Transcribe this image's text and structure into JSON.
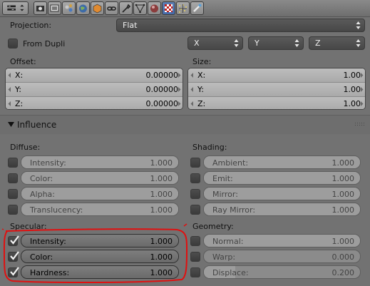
{
  "toolbar": {
    "icons": [
      "menu-toggle-icon",
      "render-icon",
      "render-layers-icon",
      "scene-icon",
      "world-icon",
      "object-icon",
      "constraints-icon",
      "modifiers-icon",
      "data-icon",
      "material-icon",
      "texture-icon",
      "particles-icon",
      "physics-icon"
    ],
    "active_index": 10
  },
  "mapping": {
    "projection_label": "Projection:",
    "projection_value": "Flat",
    "from_dupli_label": "From Dupli",
    "axes": [
      "X",
      "Y",
      "Z"
    ]
  },
  "offset": {
    "label": "Offset:",
    "rows": [
      {
        "axis": "X:",
        "value": "0.00000"
      },
      {
        "axis": "Y:",
        "value": "0.00000"
      },
      {
        "axis": "Z:",
        "value": "0.00000"
      }
    ]
  },
  "size": {
    "label": "Size:",
    "rows": [
      {
        "axis": "X:",
        "value": "1.00"
      },
      {
        "axis": "Y:",
        "value": "1.00"
      },
      {
        "axis": "Z:",
        "value": "1.00"
      }
    ]
  },
  "influence": {
    "title": "Influence",
    "diffuse": {
      "label": "Diffuse:",
      "items": [
        {
          "label": "Intensity:",
          "value": "1.000",
          "checked": false,
          "fill": 1.0
        },
        {
          "label": "Color:",
          "value": "1.000",
          "checked": false,
          "fill": 1.0
        },
        {
          "label": "Alpha:",
          "value": "1.000",
          "checked": false,
          "fill": 1.0
        },
        {
          "label": "Translucency:",
          "value": "1.000",
          "checked": false,
          "fill": 1.0
        }
      ]
    },
    "shading": {
      "label": "Shading:",
      "items": [
        {
          "label": "Ambient:",
          "value": "1.000",
          "checked": false,
          "fill": 1.0
        },
        {
          "label": "Emit:",
          "value": "1.000",
          "checked": false,
          "fill": 1.0
        },
        {
          "label": "Mirror:",
          "value": "1.000",
          "checked": false,
          "fill": 1.0
        },
        {
          "label": "Ray Mirror:",
          "value": "1.000",
          "checked": false,
          "fill": 1.0
        }
      ]
    },
    "specular": {
      "label": "Specular:",
      "items": [
        {
          "label": "Intensity:",
          "value": "1.000",
          "checked": true,
          "fill": 1.0
        },
        {
          "label": "Color:",
          "value": "1.000",
          "checked": true,
          "fill": 1.0
        },
        {
          "label": "Hardness:",
          "value": "1.000",
          "checked": true,
          "fill": 1.0
        }
      ]
    },
    "geometry": {
      "label": "Geometry:",
      "items": [
        {
          "label": "Normal:",
          "value": "1.000",
          "checked": false,
          "fill": 1.0
        },
        {
          "label": "Warp:",
          "value": "0.000",
          "checked": false,
          "fill": 0.0
        },
        {
          "label": "Displace:",
          "value": "0.200",
          "checked": false,
          "fill": 0.2
        }
      ]
    }
  },
  "colors": {
    "background": "#727272",
    "active_tab": "#5d7fb3",
    "highlight_annotation": "#e01010"
  }
}
